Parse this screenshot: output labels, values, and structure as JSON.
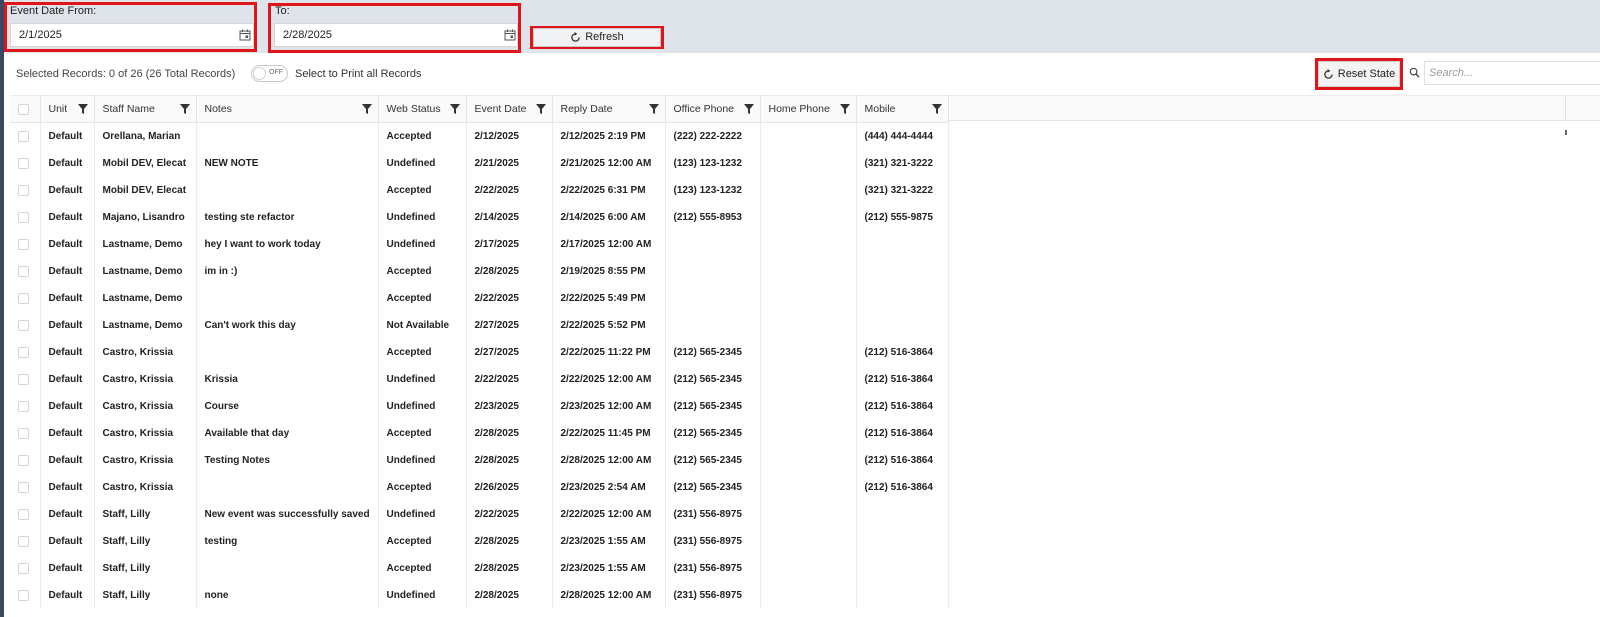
{
  "filters": {
    "from_label": "Event Date From:",
    "from_value": "2/1/2025",
    "to_label": "To:",
    "to_value": "2/28/2025",
    "refresh_label": "Refresh"
  },
  "toolbar": {
    "selected_text": "Selected Records: 0 of 26 (26 Total Records)",
    "toggle_text": "OFF",
    "print_text": "Select to Print all Records",
    "reset_label": "Reset State",
    "search_placeholder": "Search..."
  },
  "colors": {
    "highlight": "#e0141b",
    "top_band": "#dfe3ea",
    "accent": "#3b4863"
  },
  "columns": [
    "Unit",
    "Staff Name",
    "Notes",
    "Web Status",
    "Event Date",
    "Reply Date",
    "Office Phone",
    "Home Phone",
    "Mobile"
  ],
  "rows": [
    [
      "Default",
      "Orellana, Marian",
      "",
      "Accepted",
      "2/12/2025",
      "2/12/2025 2:19 PM",
      "(222) 222-2222",
      "",
      "(444) 444-4444"
    ],
    [
      "Default",
      "Mobil DEV, Elecat",
      "NEW NOTE",
      "Undefined",
      "2/21/2025",
      "2/21/2025 12:00 AM",
      "(123) 123-1232",
      "",
      "(321) 321-3222"
    ],
    [
      "Default",
      "Mobil DEV, Elecat",
      "",
      "Accepted",
      "2/22/2025",
      "2/22/2025 6:31 PM",
      "(123) 123-1232",
      "",
      "(321) 321-3222"
    ],
    [
      "Default",
      "Majano, Lisandro",
      "testing ste refactor",
      "Undefined",
      "2/14/2025",
      "2/14/2025 6:00 AM",
      "(212) 555-8953",
      "",
      "(212) 555-9875"
    ],
    [
      "Default",
      "Lastname, Demo",
      "hey I want to work today",
      "Undefined",
      "2/17/2025",
      "2/17/2025 12:00 AM",
      "",
      "",
      ""
    ],
    [
      "Default",
      "Lastname, Demo",
      "im in :)",
      "Accepted",
      "2/28/2025",
      "2/19/2025 8:55 PM",
      "",
      "",
      ""
    ],
    [
      "Default",
      "Lastname, Demo",
      "",
      "Accepted",
      "2/22/2025",
      "2/22/2025 5:49 PM",
      "",
      "",
      ""
    ],
    [
      "Default",
      "Lastname, Demo",
      "Can't work this day",
      "Not Available",
      "2/27/2025",
      "2/22/2025 5:52 PM",
      "",
      "",
      ""
    ],
    [
      "Default",
      "Castro, Krissia",
      "",
      "Accepted",
      "2/27/2025",
      "2/22/2025 11:22 PM",
      "(212) 565-2345",
      "",
      "(212) 516-3864"
    ],
    [
      "Default",
      "Castro, Krissia",
      "Krissia",
      "Undefined",
      "2/22/2025",
      "2/22/2025 12:00 AM",
      "(212) 565-2345",
      "",
      "(212) 516-3864"
    ],
    [
      "Default",
      "Castro, Krissia",
      "Course",
      "Undefined",
      "2/23/2025",
      "2/23/2025 12:00 AM",
      "(212) 565-2345",
      "",
      "(212) 516-3864"
    ],
    [
      "Default",
      "Castro, Krissia",
      "Available that day",
      "Accepted",
      "2/28/2025",
      "2/22/2025 11:45 PM",
      "(212) 565-2345",
      "",
      "(212) 516-3864"
    ],
    [
      "Default",
      "Castro, Krissia",
      "Testing Notes",
      "Undefined",
      "2/28/2025",
      "2/28/2025 12:00 AM",
      "(212) 565-2345",
      "",
      "(212) 516-3864"
    ],
    [
      "Default",
      "Castro, Krissia",
      "",
      "Accepted",
      "2/26/2025",
      "2/23/2025 2:54 AM",
      "(212) 565-2345",
      "",
      "(212) 516-3864"
    ],
    [
      "Default",
      "Staff, Lilly",
      "New event was successfully saved",
      "Undefined",
      "2/22/2025",
      "2/22/2025 12:00 AM",
      "(231) 556-8975",
      "",
      ""
    ],
    [
      "Default",
      "Staff, Lilly",
      "testing",
      "Accepted",
      "2/28/2025",
      "2/23/2025 1:55 AM",
      "(231) 556-8975",
      "",
      ""
    ],
    [
      "Default",
      "Staff, Lilly",
      "",
      "Accepted",
      "2/28/2025",
      "2/23/2025 1:55 AM",
      "(231) 556-8975",
      "",
      ""
    ],
    [
      "Default",
      "Staff, Lilly",
      "none",
      "Undefined",
      "2/28/2025",
      "2/28/2025 12:00 AM",
      "(231) 556-8975",
      "",
      ""
    ]
  ]
}
